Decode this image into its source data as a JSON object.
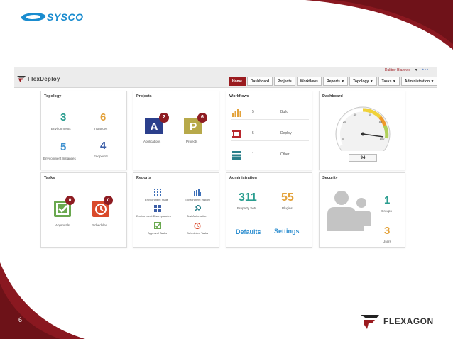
{
  "slide": {
    "brand_left": "SYSCO",
    "brand_right": "FLEXAGON",
    "page_number": "6",
    "colors": {
      "maroon": "#8a1820",
      "dark_maroon": "#5a0f14",
      "sysco_blue": "#1a8ccf"
    }
  },
  "app": {
    "logo": "FlexDeploy",
    "user": "Dalibor Blazevic",
    "user_caret": "▼",
    "more": "•••",
    "nav": [
      {
        "label": "Home",
        "active": true
      },
      {
        "label": "Dashboard"
      },
      {
        "label": "Projects"
      },
      {
        "label": "Workflows"
      },
      {
        "label": "Reports ▼"
      },
      {
        "label": "Topology ▼"
      },
      {
        "label": "Tasks ▼"
      },
      {
        "label": "Administration ▼"
      }
    ]
  },
  "panels": {
    "topology": {
      "title": "Topology",
      "environments": {
        "count": "3",
        "label": "Environments",
        "color": "#2a9d8f"
      },
      "instances": {
        "count": "6",
        "label": "Instances",
        "color": "#e3a23b"
      },
      "environment_instances": {
        "count": "5",
        "label": "Environment Instances",
        "color": "#3b8fcf"
      },
      "endpoints": {
        "count": "4",
        "label": "Endpoints",
        "color": "#3d5fa8"
      }
    },
    "projects": {
      "title": "Projects",
      "applications": {
        "label": "Applications",
        "badge": "2"
      },
      "projects": {
        "label": "Projects",
        "badge": "6"
      }
    },
    "workflows": {
      "title": "Workflows",
      "rows": [
        {
          "count": "5",
          "label": "Build",
          "icon": "build-icon"
        },
        {
          "count": "5",
          "label": "Deploy",
          "icon": "deploy-icon"
        },
        {
          "count": "1",
          "label": "Other",
          "icon": "other-icon"
        }
      ]
    },
    "dashboard": {
      "title": "Dashboard",
      "gauge_value": "94",
      "gauge_ticks": [
        "0",
        "20",
        "40",
        "60",
        "80",
        "100"
      ]
    },
    "tasks": {
      "title": "Tasks",
      "approvals": {
        "label": "Approvals",
        "badge": "0"
      },
      "scheduled": {
        "label": "Scheduled",
        "badge": "0"
      }
    },
    "reports": {
      "title": "Reports",
      "items": [
        {
          "label": "Environment State"
        },
        {
          "label": "Environment History"
        },
        {
          "label": "Environment Discrepancies"
        },
        {
          "label": "Test Automation"
        },
        {
          "label": "Approval Tasks"
        },
        {
          "label": "Scheduled Tasks"
        }
      ]
    },
    "administration": {
      "title": "Administration",
      "property_sets": {
        "count": "311",
        "label": "Property Sets",
        "color": "#2a9d8f"
      },
      "plugins": {
        "count": "55",
        "label": "Plugins",
        "color": "#e3a23b"
      },
      "defaults_label": "Defaults",
      "settings_label": "Settings",
      "link_color": "#2f8fd0"
    },
    "security": {
      "title": "Security",
      "groups": {
        "count": "1",
        "label": "Groups",
        "color": "#2a9d8f"
      },
      "users": {
        "count": "3",
        "label": "Users",
        "color": "#e3a23b"
      }
    }
  }
}
